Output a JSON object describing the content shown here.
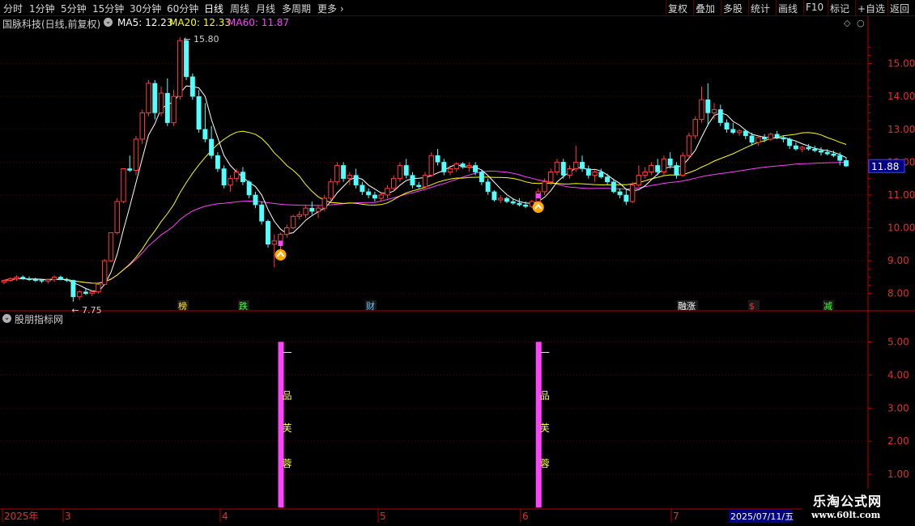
{
  "toolbar": {
    "left": [
      "分时",
      "1分钟",
      "5分钟",
      "15分钟",
      "30分钟",
      "60分钟",
      "日线",
      "周线",
      "月线",
      "多周期",
      "更多"
    ],
    "active": "日线",
    "right": [
      "复权",
      "叠加",
      "多股",
      "统计",
      "画线",
      "F10",
      "标记",
      "+自选",
      "返回"
    ]
  },
  "stock": {
    "title": "国脉科技(日线,前复权)",
    "ma5_label": "MA5:",
    "ma5": "12.23",
    "ma20_label": "MA20:",
    "ma20": "12.33",
    "ma60_label": "MA60:",
    "ma60": "11.87"
  },
  "colors": {
    "up": "#ff3c3c",
    "down": "#54ffff",
    "ma5": "#ffffff",
    "ma20": "#ffff00",
    "ma60": "#ff40ff",
    "axis": "#b40000",
    "grid": "#5a0000",
    "signal": "#ff44ff"
  },
  "price_axis": {
    "ticks": [
      "15.00",
      "14.00",
      "13.00",
      "12.00",
      "11.00",
      "10.00",
      "9.00",
      "8.00"
    ],
    "current": "11.88"
  },
  "annotations": {
    "high": "15.80",
    "low": "7.75"
  },
  "event_markers": [
    "榜",
    "跌",
    "财",
    "融涨",
    "$",
    "减"
  ],
  "indicator": {
    "title": "股朋指标网",
    "ticks": [
      "5.00",
      "4.00",
      "3.00",
      "2.00",
      "1.00"
    ],
    "signal_text": [
      "一",
      "品",
      "芙",
      "蓉"
    ]
  },
  "time_axis": {
    "labels": [
      "2025年",
      "3",
      "4",
      "5",
      "6",
      "7"
    ],
    "cursor_date": "2025/07/11/五"
  },
  "brand": {
    "name": "乐淘公式网",
    "url": "www.60lt.com"
  },
  "chart_data": {
    "type": "candlestick",
    "title": "国脉科技(日线,前复权)",
    "ylim": [
      7.5,
      16.0
    ],
    "indicator_ylim": [
      0,
      5.5
    ],
    "candles": [
      [
        8.35,
        8.42,
        8.28,
        8.4
      ],
      [
        8.4,
        8.5,
        8.35,
        8.45
      ],
      [
        8.45,
        8.55,
        8.38,
        8.5
      ],
      [
        8.5,
        8.55,
        8.42,
        8.45
      ],
      [
        8.45,
        8.52,
        8.38,
        8.42
      ],
      [
        8.42,
        8.48,
        8.35,
        8.4
      ],
      [
        8.4,
        8.45,
        8.32,
        8.38
      ],
      [
        8.38,
        8.45,
        8.3,
        8.42
      ],
      [
        8.42,
        8.55,
        8.35,
        8.5
      ],
      [
        8.5,
        8.55,
        8.4,
        8.42
      ],
      [
        8.42,
        8.48,
        8.35,
        8.4
      ],
      [
        8.4,
        8.42,
        7.75,
        7.9
      ],
      [
        7.9,
        8.1,
        7.8,
        8.05
      ],
      [
        8.05,
        8.15,
        7.95,
        8.0
      ],
      [
        8.0,
        8.1,
        7.92,
        8.05
      ],
      [
        8.05,
        8.3,
        8.0,
        8.28
      ],
      [
        8.28,
        9.05,
        8.25,
        9.0
      ],
      [
        9.0,
        9.8,
        8.95,
        9.85
      ],
      [
        9.85,
        10.9,
        9.8,
        10.8
      ],
      [
        10.8,
        11.8,
        10.75,
        11.8
      ],
      [
        11.8,
        12.2,
        11.7,
        11.75
      ],
      [
        11.75,
        12.8,
        11.6,
        12.7
      ],
      [
        12.7,
        13.6,
        12.55,
        13.5
      ],
      [
        13.5,
        14.5,
        13.4,
        14.4
      ],
      [
        14.4,
        14.5,
        13.3,
        13.5
      ],
      [
        13.5,
        14.3,
        13.4,
        14.1
      ],
      [
        14.1,
        14.55,
        13.1,
        13.2
      ],
      [
        13.2,
        14.2,
        13.1,
        14.0
      ],
      [
        14.0,
        15.8,
        13.9,
        15.7
      ],
      [
        15.7,
        15.75,
        14.5,
        14.6
      ],
      [
        14.6,
        14.7,
        13.9,
        14.0
      ],
      [
        14.0,
        14.2,
        12.9,
        13.0
      ],
      [
        13.0,
        13.8,
        12.6,
        12.7
      ],
      [
        12.7,
        13.1,
        12.1,
        12.2
      ],
      [
        12.2,
        12.3,
        11.7,
        11.8
      ],
      [
        11.8,
        11.9,
        11.2,
        11.3
      ],
      [
        11.3,
        11.6,
        11.1,
        11.5
      ],
      [
        11.5,
        11.8,
        11.4,
        11.7
      ],
      [
        11.7,
        11.85,
        11.3,
        11.4
      ],
      [
        11.4,
        11.45,
        10.9,
        11.0
      ],
      [
        11.0,
        11.1,
        10.6,
        10.7
      ],
      [
        10.7,
        10.8,
        10.1,
        10.2
      ],
      [
        10.2,
        10.25,
        9.4,
        9.5
      ],
      [
        9.5,
        9.8,
        8.8,
        9.6
      ],
      [
        9.6,
        9.85,
        9.3,
        9.8
      ],
      [
        9.8,
        10.1,
        9.7,
        10.0
      ],
      [
        10.0,
        10.4,
        9.95,
        10.35
      ],
      [
        10.35,
        10.5,
        10.25,
        10.4
      ],
      [
        10.4,
        10.7,
        10.3,
        10.6
      ],
      [
        10.6,
        10.8,
        10.4,
        10.5
      ],
      [
        10.5,
        10.7,
        10.3,
        10.6
      ],
      [
        10.6,
        11.0,
        10.5,
        10.9
      ],
      [
        10.9,
        11.5,
        10.8,
        11.4
      ],
      [
        11.4,
        12.0,
        11.3,
        11.9
      ],
      [
        11.9,
        12.0,
        11.4,
        11.5
      ],
      [
        11.5,
        11.7,
        11.3,
        11.6
      ],
      [
        11.6,
        11.8,
        11.2,
        11.3
      ],
      [
        11.3,
        11.4,
        11.0,
        11.1
      ],
      [
        11.1,
        11.2,
        10.9,
        11.0
      ],
      [
        11.0,
        11.1,
        10.8,
        10.9
      ],
      [
        10.9,
        11.1,
        10.8,
        11.0
      ],
      [
        11.0,
        11.3,
        10.9,
        11.2
      ],
      [
        11.2,
        11.6,
        11.1,
        11.5
      ],
      [
        11.5,
        12.0,
        11.4,
        11.9
      ],
      [
        11.9,
        12.1,
        11.5,
        11.6
      ],
      [
        11.6,
        11.7,
        11.2,
        11.3
      ],
      [
        11.3,
        11.4,
        11.2,
        11.25
      ],
      [
        11.25,
        11.7,
        11.2,
        11.6
      ],
      [
        11.6,
        12.3,
        11.55,
        12.2
      ],
      [
        12.2,
        12.4,
        11.9,
        12.0
      ],
      [
        12.0,
        12.1,
        11.6,
        11.7
      ],
      [
        11.7,
        11.85,
        11.6,
        11.8
      ],
      [
        11.8,
        12.0,
        11.7,
        11.95
      ],
      [
        11.95,
        12.0,
        11.8,
        11.85
      ],
      [
        11.85,
        12.0,
        11.7,
        11.9
      ],
      [
        11.9,
        12.0,
        11.6,
        11.7
      ],
      [
        11.7,
        11.75,
        11.3,
        11.4
      ],
      [
        11.4,
        11.5,
        11.0,
        11.1
      ],
      [
        11.1,
        11.15,
        10.8,
        10.85
      ],
      [
        10.85,
        11.0,
        10.75,
        10.9
      ],
      [
        10.9,
        10.95,
        10.75,
        10.8
      ],
      [
        10.8,
        10.9,
        10.7,
        10.75
      ],
      [
        10.75,
        10.9,
        10.65,
        10.7
      ],
      [
        10.7,
        10.8,
        10.6,
        10.65
      ],
      [
        10.65,
        10.85,
        10.6,
        10.8
      ],
      [
        10.8,
        11.2,
        10.75,
        11.1
      ],
      [
        11.1,
        11.5,
        11.0,
        11.4
      ],
      [
        11.4,
        11.8,
        11.3,
        11.7
      ],
      [
        11.7,
        12.1,
        11.6,
        12.0
      ],
      [
        12.0,
        12.1,
        11.5,
        11.6
      ],
      [
        11.6,
        11.9,
        11.5,
        11.8
      ],
      [
        11.8,
        12.5,
        11.7,
        12.0
      ],
      [
        12.0,
        12.2,
        11.7,
        11.8
      ],
      [
        11.8,
        11.9,
        11.5,
        11.6
      ],
      [
        11.6,
        11.75,
        11.4,
        11.7
      ],
      [
        11.7,
        11.8,
        11.5,
        11.55
      ],
      [
        11.55,
        11.65,
        11.3,
        11.4
      ],
      [
        11.4,
        11.5,
        11.05,
        11.1
      ],
      [
        11.1,
        11.2,
        10.9,
        11.0
      ],
      [
        11.0,
        11.2,
        10.7,
        10.8
      ],
      [
        10.8,
        11.4,
        10.75,
        11.3
      ],
      [
        11.3,
        11.9,
        11.25,
        11.6
      ],
      [
        11.6,
        11.85,
        11.5,
        11.7
      ],
      [
        11.7,
        12.0,
        11.6,
        11.9
      ],
      [
        11.9,
        12.1,
        11.6,
        11.7
      ],
      [
        11.7,
        12.2,
        11.6,
        12.1
      ],
      [
        12.1,
        12.3,
        11.8,
        11.9
      ],
      [
        11.9,
        12.0,
        11.5,
        11.6
      ],
      [
        11.6,
        12.3,
        11.55,
        12.2
      ],
      [
        12.2,
        12.9,
        12.1,
        12.8
      ],
      [
        12.8,
        13.4,
        12.7,
        13.3
      ],
      [
        13.3,
        14.3,
        13.2,
        13.9
      ],
      [
        13.9,
        14.4,
        13.1,
        13.5
      ],
      [
        13.5,
        13.8,
        13.3,
        13.6
      ],
      [
        13.6,
        13.75,
        13.1,
        13.2
      ],
      [
        13.2,
        13.3,
        12.9,
        13.0
      ],
      [
        13.0,
        13.2,
        12.85,
        12.9
      ],
      [
        12.9,
        13.0,
        12.8,
        12.95
      ],
      [
        12.95,
        13.0,
        12.7,
        12.8
      ],
      [
        12.8,
        12.9,
        12.5,
        12.6
      ],
      [
        12.6,
        12.8,
        12.5,
        12.75
      ],
      [
        12.75,
        12.85,
        12.6,
        12.7
      ],
      [
        12.7,
        12.9,
        12.65,
        12.85
      ],
      [
        12.85,
        12.95,
        12.7,
        12.75
      ],
      [
        12.75,
        12.8,
        12.6,
        12.7
      ],
      [
        12.7,
        12.75,
        12.4,
        12.5
      ],
      [
        12.5,
        12.6,
        12.35,
        12.4
      ],
      [
        12.4,
        12.5,
        12.3,
        12.45
      ],
      [
        12.45,
        12.55,
        12.35,
        12.4
      ],
      [
        12.4,
        12.5,
        12.3,
        12.35
      ],
      [
        12.35,
        12.45,
        12.2,
        12.3
      ],
      [
        12.3,
        12.4,
        12.2,
        12.25
      ],
      [
        12.25,
        12.35,
        12.15,
        12.2
      ],
      [
        12.2,
        12.3,
        11.9,
        12.05
      ],
      [
        12.05,
        12.15,
        11.85,
        11.88
      ]
    ],
    "signals": [
      {
        "index": 44,
        "value": 5.0
      },
      {
        "index": 85,
        "value": 5.0
      }
    ]
  }
}
